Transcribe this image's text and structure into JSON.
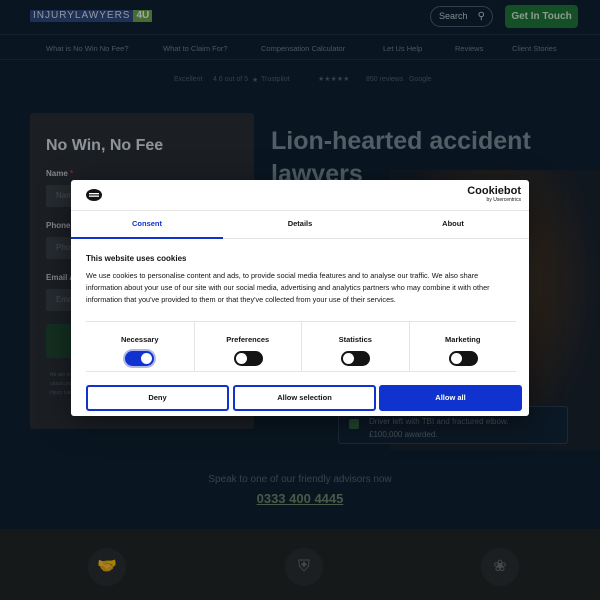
{
  "header": {
    "logo_part1": "INJURYLAWYERS",
    "logo_part2": "4U",
    "search_label": "Search",
    "cta_label": "Get In Touch"
  },
  "nav": {
    "items": [
      {
        "label": "What is No Win No Fee?"
      },
      {
        "label": "What to Claim For?"
      },
      {
        "label": "Compensation Calculator"
      },
      {
        "label": "Let Us Help"
      },
      {
        "label": "Reviews"
      },
      {
        "label": "Client Stories"
      }
    ]
  },
  "trust": {
    "excellent": "Excellent",
    "score": "4.6 out of 5",
    "trustpilot": "Trustpilot",
    "reviews": "850 reviews",
    "google": "Google"
  },
  "form": {
    "title": "No Win, No Fee",
    "name_label": "Name",
    "name_placeholder": "Name",
    "phone_label": "Phone N",
    "phone_placeholder": "Phone",
    "email_label": "Email Ad",
    "email_placeholder": "Email",
    "required_mark": "*",
    "small_print": "No win no fee unsuccessful form, you Injury Law"
  },
  "hero": {
    "title": "Lion-hearted accident lawyers",
    "review_line1": "Driver left with TBI and fractured elbow.",
    "review_line2": "£100,000 awarded."
  },
  "speak": {
    "text": "Speak to one of our friendly advisors now",
    "phone": "0333 400 4445"
  },
  "cookie": {
    "brand": "Cookiebot",
    "brand_sub": "by Usercentrics",
    "tabs": [
      {
        "label": "Consent"
      },
      {
        "label": "Details"
      },
      {
        "label": "About"
      }
    ],
    "heading": "This website uses cookies",
    "body": "We use cookies to personalise content and ads, to provide social media features and to analyse our traffic. We also share information about your use of our site with our social media, advertising and analytics partners who may combine it with other information that you've provided to them or that they've collected from your use of their services.",
    "toggles": [
      {
        "label": "Necessary",
        "on": true
      },
      {
        "label": "Preferences",
        "on": false
      },
      {
        "label": "Statistics",
        "on": false
      },
      {
        "label": "Marketing",
        "on": false
      }
    ],
    "deny_label": "Deny",
    "allow_selection_label": "Allow selection",
    "allow_all_label": "Allow all",
    "accent_color": "#1032cf"
  }
}
